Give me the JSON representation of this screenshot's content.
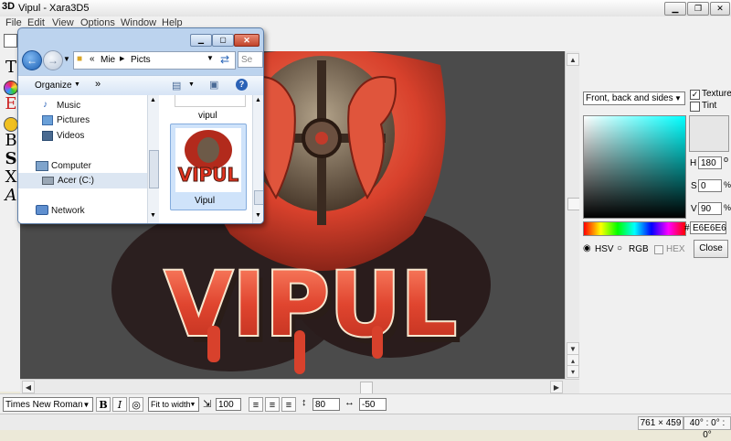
{
  "window": {
    "logo": "3D",
    "title": "Vipul - Xara3D5"
  },
  "menu": [
    "File",
    "Edit",
    "View",
    "Options",
    "Window",
    "Help"
  ],
  "left_tools": [
    "T",
    "E",
    "B",
    "S",
    "X",
    "A"
  ],
  "right_panel": {
    "face_select": "Front, back and sides",
    "texture_label": "Texture",
    "tint_label": "Tint",
    "h_label": "H",
    "h_value": "180",
    "h_unit": "o",
    "s_label": "S",
    "s_value": "0",
    "s_unit": "%",
    "v_label": "V",
    "v_value": "90",
    "v_unit": "%",
    "hex_prefix": "#",
    "hex_value": "E6E6E6",
    "mode_hsv": "HSV",
    "mode_rgb": "RGB",
    "mode_hex": "HEX",
    "close_label": "Close"
  },
  "bottom_toolbar": {
    "font": "Times New Roman",
    "bold": "B",
    "italic": "I",
    "fit": "Fit to width",
    "size_value": "100",
    "line_spacing": "80",
    "char_spacing": "-50"
  },
  "status": {
    "size": "761 × 459",
    "angle": "40° : 0° : 0°"
  },
  "explorer": {
    "breadcrumb_prefix": "«",
    "breadcrumb": [
      "Mie",
      "Picts"
    ],
    "search_placeholder": "Se",
    "organize": "Organize",
    "more": "»",
    "nav": [
      "Music",
      "Pictures",
      "Videos",
      "Computer",
      "Acer (C:)",
      "Network"
    ],
    "file_above": "vipul",
    "file_selected": "Vipul",
    "thumb_text": "VIPUL"
  },
  "artwork": {
    "text": "VIPUL"
  },
  "colors": {
    "canvas_bg": "#4b4b4b",
    "text_red": "#e04a36",
    "dragon": "#d8412c"
  }
}
